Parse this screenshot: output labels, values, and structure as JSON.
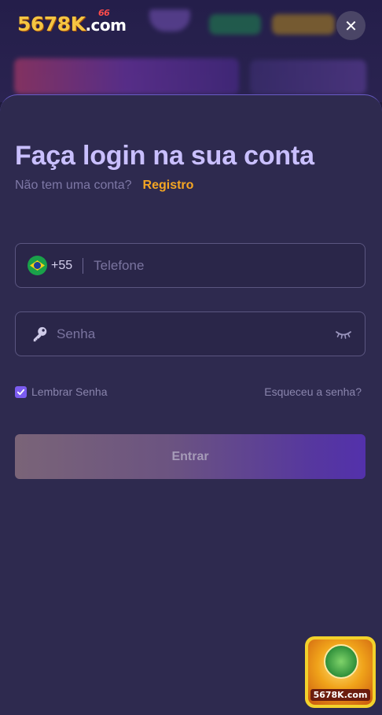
{
  "background": {
    "logo_main": "5678K",
    "logo_suffix": ".com",
    "logo_badge": "66"
  },
  "close_icon": "✕",
  "login": {
    "title": "Faça login na sua conta",
    "no_account": "Não tem uma conta?",
    "register_link": "Registro",
    "phone": {
      "flag": "brazil-flag",
      "dial_code": "+55",
      "placeholder": "Telefone",
      "value": ""
    },
    "password": {
      "placeholder": "Senha",
      "value": ""
    },
    "remember_label": "Lembrar Senha",
    "remember_checked": true,
    "forgot_link": "Esqueceu a senha?",
    "submit_label": "Entrar"
  },
  "float_widget": {
    "logo": "5678K.com"
  },
  "colors": {
    "sheet_bg": "#2e2a4f",
    "title": "#c9bfff",
    "link_accent": "#f5a623",
    "checkbox": "#7b5cf0"
  }
}
